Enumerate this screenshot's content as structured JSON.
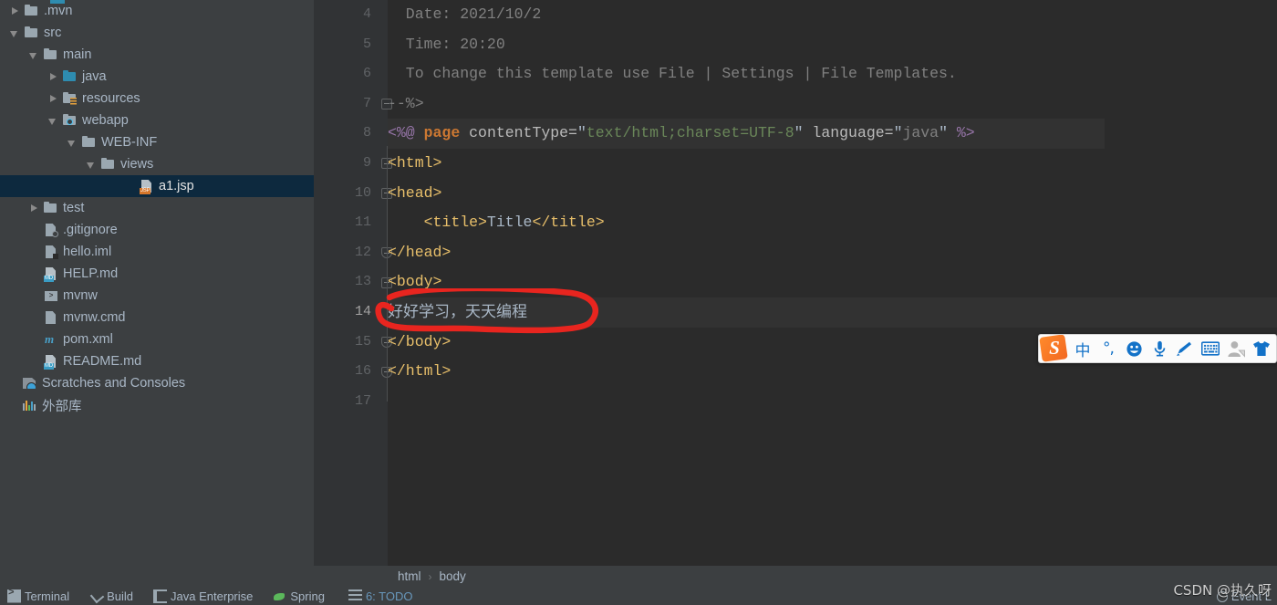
{
  "sidebar": {
    "name": "project-tree",
    "items": [
      {
        "label": ".mvn",
        "indent": 10,
        "arrow": "closed",
        "icon": "folder-icon",
        "selected": false
      },
      {
        "label": "src",
        "indent": 10,
        "arrow": "open",
        "icon": "folder-icon",
        "selected": false
      },
      {
        "label": "main",
        "indent": 31,
        "arrow": "open",
        "icon": "folder-icon",
        "selected": false
      },
      {
        "label": "java",
        "indent": 52,
        "arrow": "closed",
        "icon": "folder-blue-icon",
        "selected": false
      },
      {
        "label": "resources",
        "indent": 52,
        "arrow": "closed",
        "icon": "folder-resources-icon",
        "selected": false
      },
      {
        "label": "webapp",
        "indent": 52,
        "arrow": "open",
        "icon": "folder-webapp-icon",
        "selected": false
      },
      {
        "label": "WEB-INF",
        "indent": 73,
        "arrow": "open",
        "icon": "folder-icon",
        "selected": false
      },
      {
        "label": "views",
        "indent": 94,
        "arrow": "open",
        "icon": "folder-icon",
        "selected": false
      },
      {
        "label": "a1.jsp",
        "indent": 136,
        "arrow": "none",
        "icon": "jsp-file-icon",
        "selected": true
      },
      {
        "label": "test",
        "indent": 31,
        "arrow": "closed",
        "icon": "folder-icon",
        "selected": false
      },
      {
        "label": ".gitignore",
        "indent": 31,
        "arrow": "none",
        "icon": "gitignore-file-icon",
        "selected": false
      },
      {
        "label": "hello.iml",
        "indent": 31,
        "arrow": "none",
        "icon": "iml-file-icon",
        "selected": false
      },
      {
        "label": "HELP.md",
        "indent": 31,
        "arrow": "none",
        "icon": "markdown-file-icon",
        "selected": false
      },
      {
        "label": "mvnw",
        "indent": 31,
        "arrow": "none",
        "icon": "shell-script-icon",
        "selected": false
      },
      {
        "label": "mvnw.cmd",
        "indent": 31,
        "arrow": "none",
        "icon": "text-file-icon",
        "selected": false
      },
      {
        "label": "pom.xml",
        "indent": 31,
        "arrow": "none",
        "icon": "maven-pom-icon",
        "selected": false
      },
      {
        "label": "README.md",
        "indent": 31,
        "arrow": "none",
        "icon": "markdown-file-icon",
        "selected": false
      },
      {
        "label": "Scratches and Consoles",
        "indent": 8,
        "arrow": "none",
        "icon": "scratches-icon",
        "selected": false
      },
      {
        "label": "外部库",
        "indent": 8,
        "arrow": "none",
        "icon": "external-libraries-icon",
        "selected": false
      }
    ]
  },
  "editor": {
    "first_line": 4,
    "last_line": 17,
    "current_line": 14,
    "line_numbers": [
      "4",
      "5",
      "6",
      "7",
      "8",
      "9",
      "10",
      "11",
      "12",
      "13",
      "14",
      "15",
      "16",
      "17"
    ],
    "lines": {
      "l4": "  Date: 2021/10/2",
      "l5": "  Time: 20:20",
      "l6": "  To change this template use File | Settings | File Templates.",
      "l7": "--%>",
      "l8_open": "<%@",
      "l8_kw": "page",
      "l8_attr1": " contentType=",
      "l8_q1": "\"",
      "l8_val1": "text/html;charset=UTF-8",
      "l8_q2": "\"",
      "l8_attr2": " language=",
      "l8_q3": "\"",
      "l8_val2": "java",
      "l8_q4": "\"",
      "l8_close": " %>",
      "l9": "<html>",
      "l10": "<head>",
      "l11_indent": "    ",
      "l11_open": "<title>",
      "l11_text": "Title",
      "l11_close": "</title>",
      "l12": "</head>",
      "l13": "<body>",
      "l14": "好好学习，天天编程",
      "l15": "</body>",
      "l16": "</html>",
      "l17": ""
    },
    "colors": {
      "background": "#2b2b2b",
      "gutter": "#313335",
      "comment": "#808080",
      "tag": "#e8bf6a",
      "keyword": "#cc7832",
      "string": "#6a8759",
      "directive": "#9876aa",
      "text": "#a9b7c6",
      "current_line_highlight": "#323232",
      "selection": "#0d293e"
    }
  },
  "annotation": {
    "name": "red-ellipse-highlight",
    "color": "#e8251f",
    "target_text": "好好学习，天天编程"
  },
  "breadcrumb": {
    "items": [
      "html",
      "body"
    ],
    "separator": "›"
  },
  "statusbar": {
    "items": [
      {
        "label": "Terminal",
        "icon": "terminal-icon"
      },
      {
        "label": "Build",
        "icon": "build-hammer-icon"
      },
      {
        "label": "Java Enterprise",
        "icon": "java-enterprise-icon"
      },
      {
        "label": "Spring",
        "icon": "spring-leaf-icon"
      },
      {
        "label": "6: TODO",
        "icon": "todo-list-icon",
        "accent": "#6897bb"
      }
    ],
    "event_log": "Event L"
  },
  "ime": {
    "name": "sogou-input-method-toolbar",
    "logo_letter": "S",
    "logo_color": "#f26822",
    "accent": "#1372c8",
    "buttons": [
      {
        "label": "中",
        "icon": "chinese-mode-icon"
      },
      {
        "label": "°,",
        "icon": "punctuation-mode-icon"
      },
      {
        "label": "",
        "icon": "emoji-icon"
      },
      {
        "label": "",
        "icon": "microphone-icon"
      },
      {
        "label": "",
        "icon": "handwriting-pen-icon"
      },
      {
        "label": "",
        "icon": "soft-keyboard-icon"
      },
      {
        "label": "",
        "icon": "user-account-icon"
      },
      {
        "label": "",
        "icon": "skin-tshirt-icon"
      }
    ]
  },
  "watermark": {
    "text": "CSDN @执久呀"
  }
}
